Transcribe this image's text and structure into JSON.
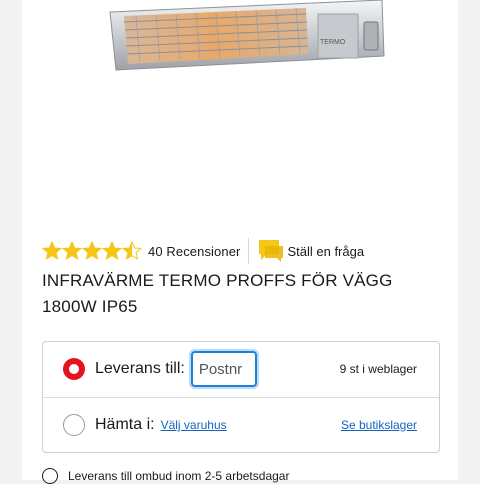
{
  "rating": {
    "stars": 4.5,
    "max": 5,
    "star_color": "#f5c518",
    "count_label": "40 Recensioner"
  },
  "ask": {
    "label": "Ställ en fråga",
    "icon": "chat-bubble-icon"
  },
  "product": {
    "image_brand_text": "TERMO",
    "title": "INFRAVÄRME TERMO PROFFS FÖR VÄGG 1800W IP65"
  },
  "delivery": {
    "delivery_label": "Leverans till:",
    "postnr_placeholder": "Postnr",
    "stock_text": "9 st i weblager",
    "pickup_label": "Hämta i:",
    "select_store_link": "Välj varuhus",
    "store_stock_link": "Se butikslager",
    "selected": "delivery"
  },
  "note": {
    "text": "Leverans till ombud inom 2-5 arbetsdagar"
  },
  "colors": {
    "accent_red": "#e4121f",
    "link_blue": "#1565c0",
    "focus_blue": "#1e82d6"
  }
}
